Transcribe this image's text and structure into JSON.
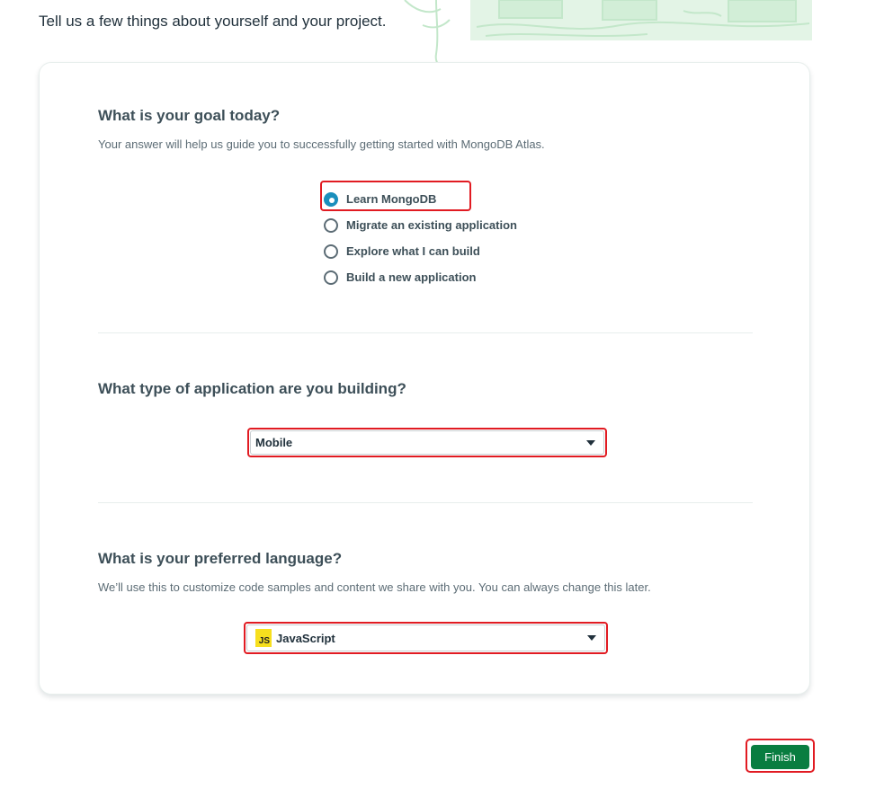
{
  "intro_text": "Tell us a few things about yourself and your project.",
  "goal": {
    "title": "What is your goal today?",
    "description": "Your answer will help us guide you to successfully getting started with MongoDB Atlas.",
    "options": [
      {
        "label": "Learn MongoDB",
        "checked": true
      },
      {
        "label": "Migrate an existing application",
        "checked": false
      },
      {
        "label": "Explore what I can build",
        "checked": false
      },
      {
        "label": "Build a new application",
        "checked": false
      }
    ]
  },
  "app_type": {
    "title": "What type of application are you building?",
    "selected": "Mobile"
  },
  "language": {
    "title": "What is your preferred language?",
    "description": "We’ll use this to customize code samples and content we share with you. You can always change this later.",
    "icon_text": "JS",
    "selected": "JavaScript"
  },
  "finish_label": "Finish",
  "colors": {
    "accent_blue": "#1a8fbc",
    "primary_green": "#097d40",
    "highlight_red": "#e11b22",
    "js_yellow": "#f7df1e"
  },
  "icons": [
    "illustration-decorative",
    "radio-checked-icon",
    "radio-unchecked-icon",
    "chevron-down-icon",
    "javascript-icon"
  ]
}
